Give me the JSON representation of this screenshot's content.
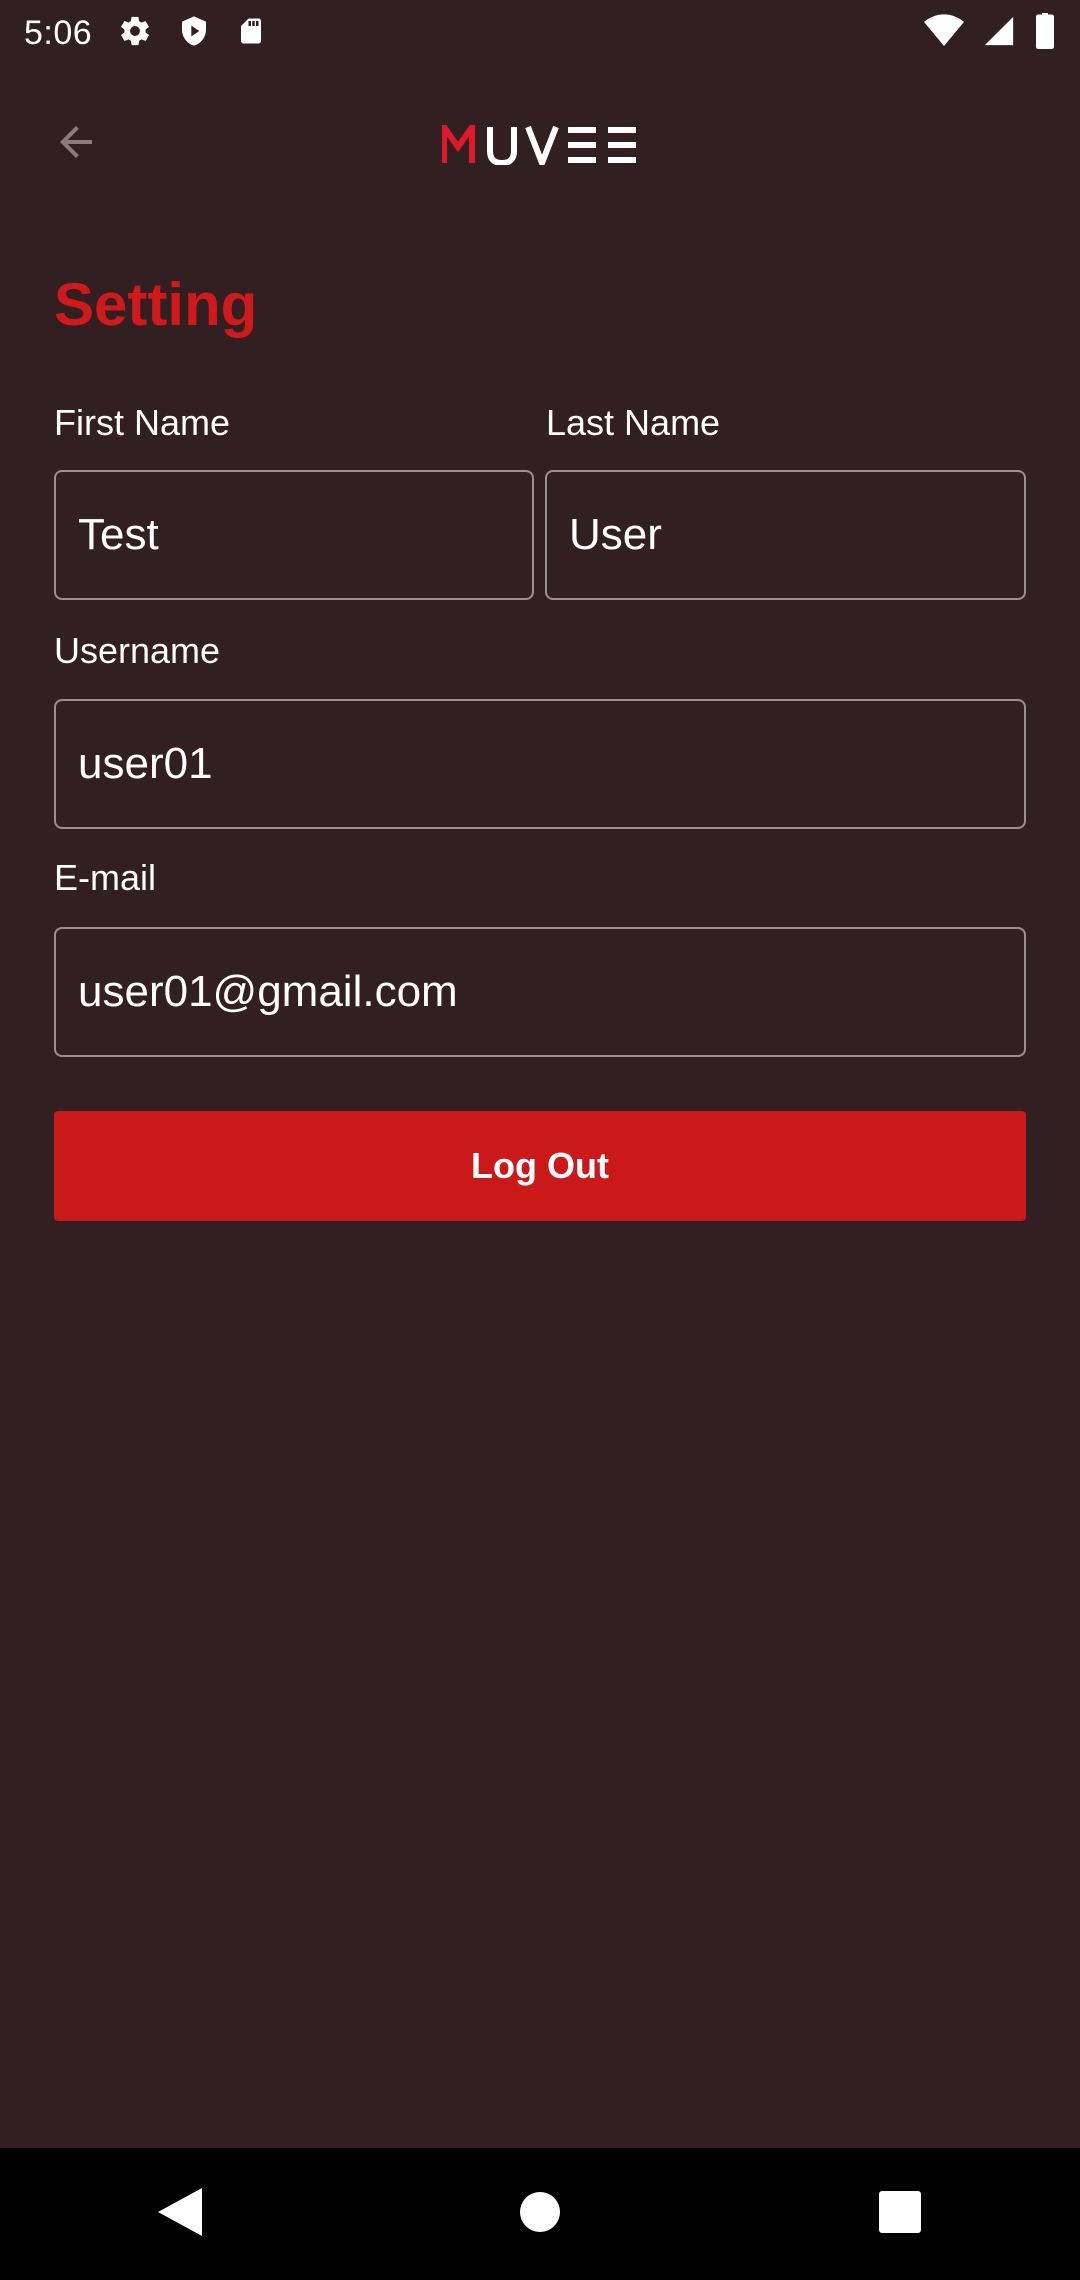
{
  "status_bar": {
    "time": "5:06",
    "left_icons": [
      "gear-icon",
      "shield-icon",
      "sd-card-icon"
    ],
    "right_icons": [
      "wifi-icon",
      "cell-signal-icon",
      "battery-icon"
    ]
  },
  "header": {
    "back_icon": "arrow-left-icon",
    "logo_text": "MUVEE",
    "logo_accent_color": "#e0192a"
  },
  "page": {
    "title": "Setting",
    "title_color": "#d0191b"
  },
  "form": {
    "first_name": {
      "label": "First Name",
      "value": "Test"
    },
    "last_name": {
      "label": "Last Name",
      "value": "User"
    },
    "username": {
      "label": "Username",
      "value": "user01"
    },
    "email": {
      "label": "E-mail",
      "value": "user01@gmail.com"
    }
  },
  "actions": {
    "logout_label": "Log Out",
    "logout_color": "#cb1819"
  },
  "nav_bar": {
    "buttons": [
      "back-triangle-icon",
      "home-circle-icon",
      "recents-square-icon"
    ]
  },
  "colors": {
    "background": "#321f21",
    "field_border": "#9c8f90"
  }
}
